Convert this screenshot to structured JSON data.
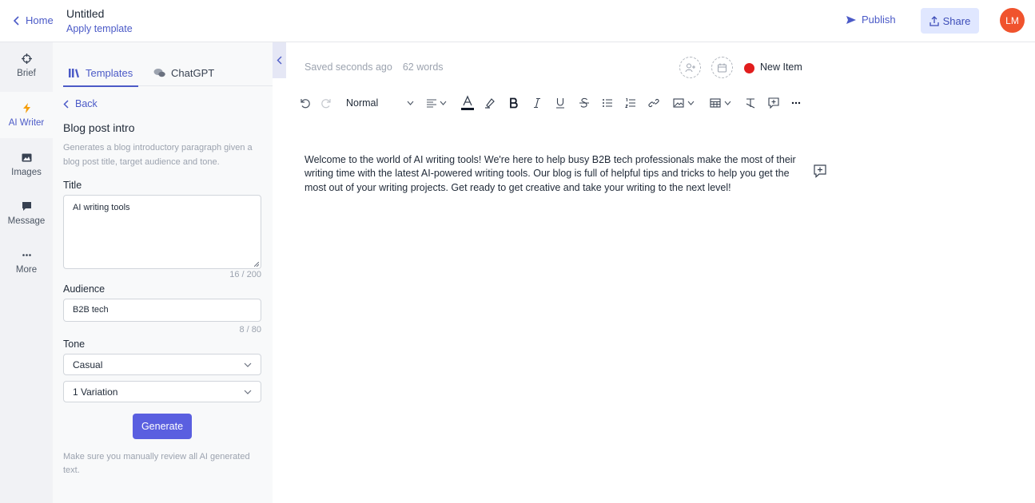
{
  "header": {
    "home_label": "Home",
    "doc_title": "Untitled",
    "apply_template": "Apply template",
    "publish_label": "Publish",
    "share_label": "Share",
    "avatar_initials": "LM",
    "accent_color": "#4b5ac7",
    "avatar_color": "#f0532d"
  },
  "rail": {
    "items": [
      {
        "label": "Brief",
        "icon": "crosshair-icon"
      },
      {
        "label": "AI Writer",
        "icon": "lightning-icon",
        "active": true
      },
      {
        "label": "Images",
        "icon": "image-icon"
      },
      {
        "label": "Message",
        "icon": "message-icon"
      },
      {
        "label": "More",
        "icon": "more-dots-icon"
      }
    ]
  },
  "panel": {
    "tabs": [
      {
        "label": "Templates",
        "icon": "library-icon",
        "active": true
      },
      {
        "label": "ChatGPT",
        "icon": "chat-bubbles-icon"
      }
    ],
    "back_label": "Back",
    "template_name": "Blog post intro",
    "template_desc": "Generates a blog introductory paragraph given a blog post title, target audience and tone.",
    "title_label": "Title",
    "title_value": "AI writing tools",
    "title_counter": "16 / 200",
    "audience_label": "Audience",
    "audience_value": "B2B tech",
    "audience_counter": "8 / 80",
    "tone_label": "Tone",
    "tone_value": "Casual",
    "variation_value": "1 Variation",
    "generate_label": "Generate",
    "note": "Make sure you manually review all AI generated text."
  },
  "editor": {
    "saved": "Saved seconds ago",
    "words": "62 words",
    "status_label": "New Item",
    "status_color": "#e11d1d",
    "style_value": "Normal",
    "body": "Welcome to the world of AI writing tools! We're here to help busy B2B tech professionals make the most of their writing time with the latest AI-powered writing tools. Our blog is full of helpful tips and tricks to help you get the most out of your writing projects. Get ready to get creative and take your writing to the next level!"
  }
}
